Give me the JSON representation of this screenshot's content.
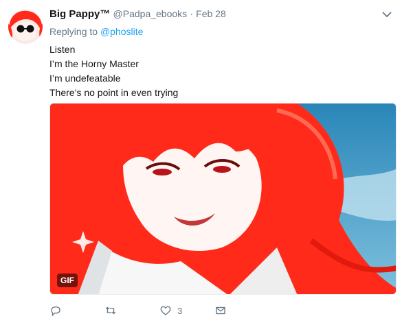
{
  "tweet": {
    "display_name": "Big Pappy™",
    "handle": "@Padpa_ebooks",
    "separator": "·",
    "timestamp": "Feb 28",
    "replying_to_label": "Replying to",
    "replying_to_mention": "@phoslite",
    "lines": [
      "Listen",
      "I’m the Horny Master",
      "I’m undefeatable",
      "There’s no point in even trying"
    ]
  },
  "media": {
    "badge": "GIF"
  },
  "actions": {
    "reply_count": "",
    "retweet_count": "",
    "like_count": "3",
    "dm_label": ""
  },
  "colors": {
    "accent": "#1da1f2",
    "muted": "#657786",
    "text": "#14171a",
    "hair": "#ff2a1a"
  },
  "icons": [
    "avatar-sunglasses-icon",
    "chevron-down-icon",
    "reply-icon",
    "retweet-icon",
    "like-icon",
    "direct-message-icon"
  ]
}
